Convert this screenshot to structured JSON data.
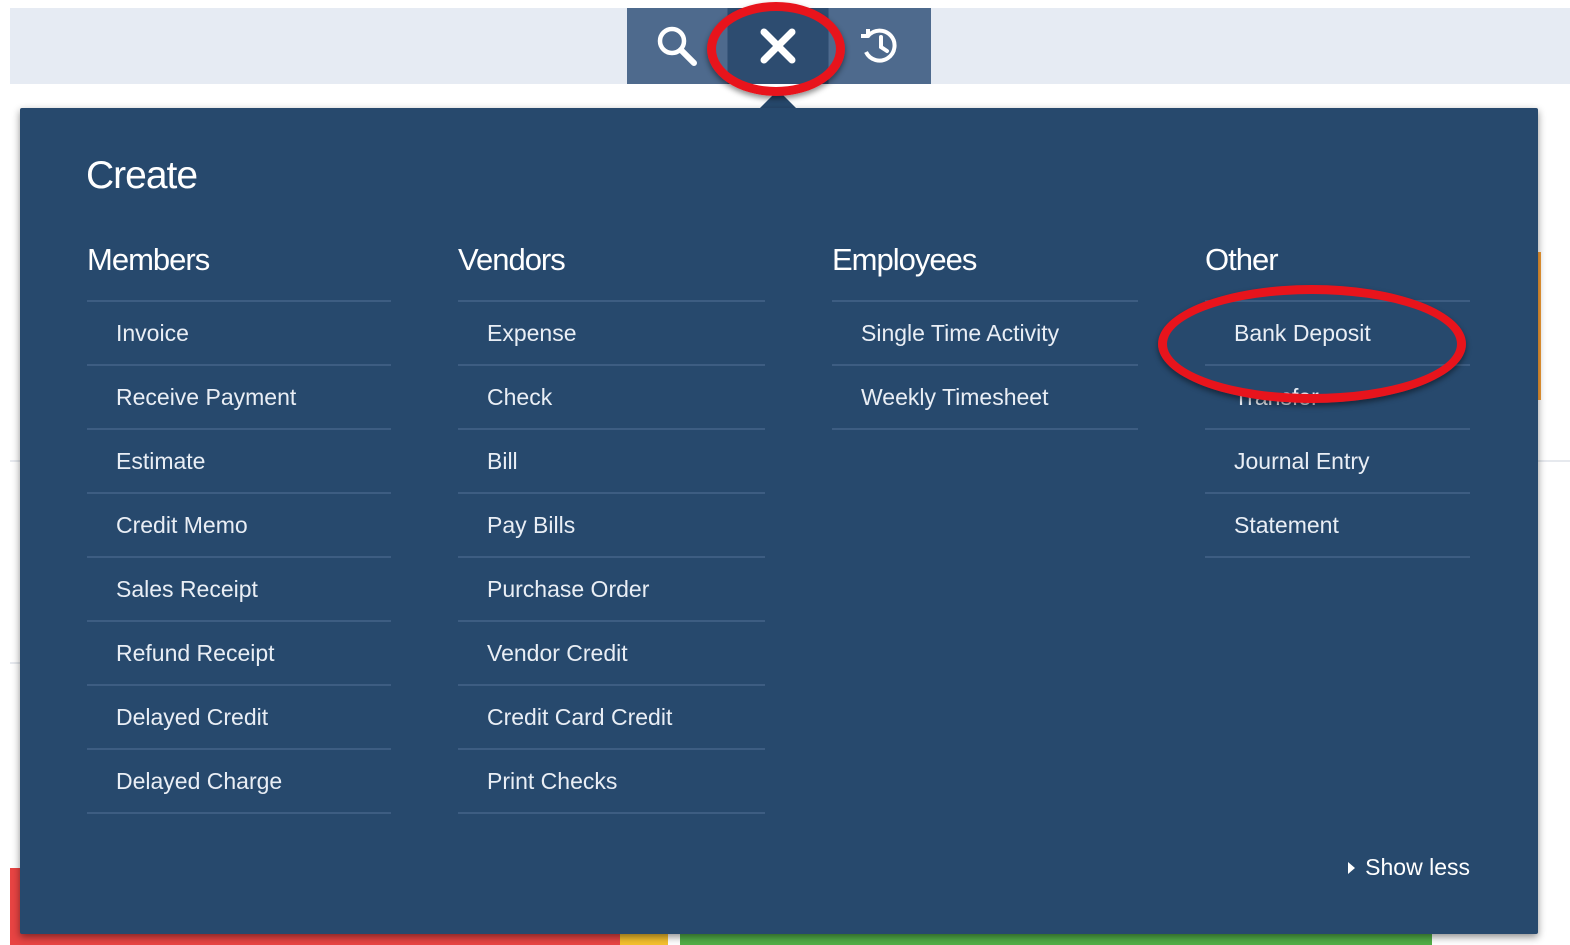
{
  "toolbar": {
    "search_icon": "search-icon",
    "close_icon": "close-icon",
    "recent_icon": "recent-transactions-icon"
  },
  "panel": {
    "title": "Create",
    "columns": [
      {
        "heading": "Members",
        "items": [
          "Invoice",
          "Receive Payment",
          "Estimate",
          "Credit Memo",
          "Sales Receipt",
          "Refund Receipt",
          "Delayed Credit",
          "Delayed Charge"
        ]
      },
      {
        "heading": "Vendors",
        "items": [
          "Expense",
          "Check",
          "Bill",
          "Pay Bills",
          "Purchase Order",
          "Vendor Credit",
          "Credit Card Credit",
          "Print Checks"
        ]
      },
      {
        "heading": "Employees",
        "items": [
          "Single Time Activity",
          "Weekly Timesheet"
        ]
      },
      {
        "heading": "Other",
        "items": [
          "Bank Deposit",
          "Transfer",
          "Journal Entry",
          "Statement"
        ]
      }
    ],
    "show_less": "Show less"
  },
  "colors": {
    "panel_bg": "#27496d",
    "toolbar_bg": "#4e6a8d",
    "highlight": "#e8141c"
  }
}
